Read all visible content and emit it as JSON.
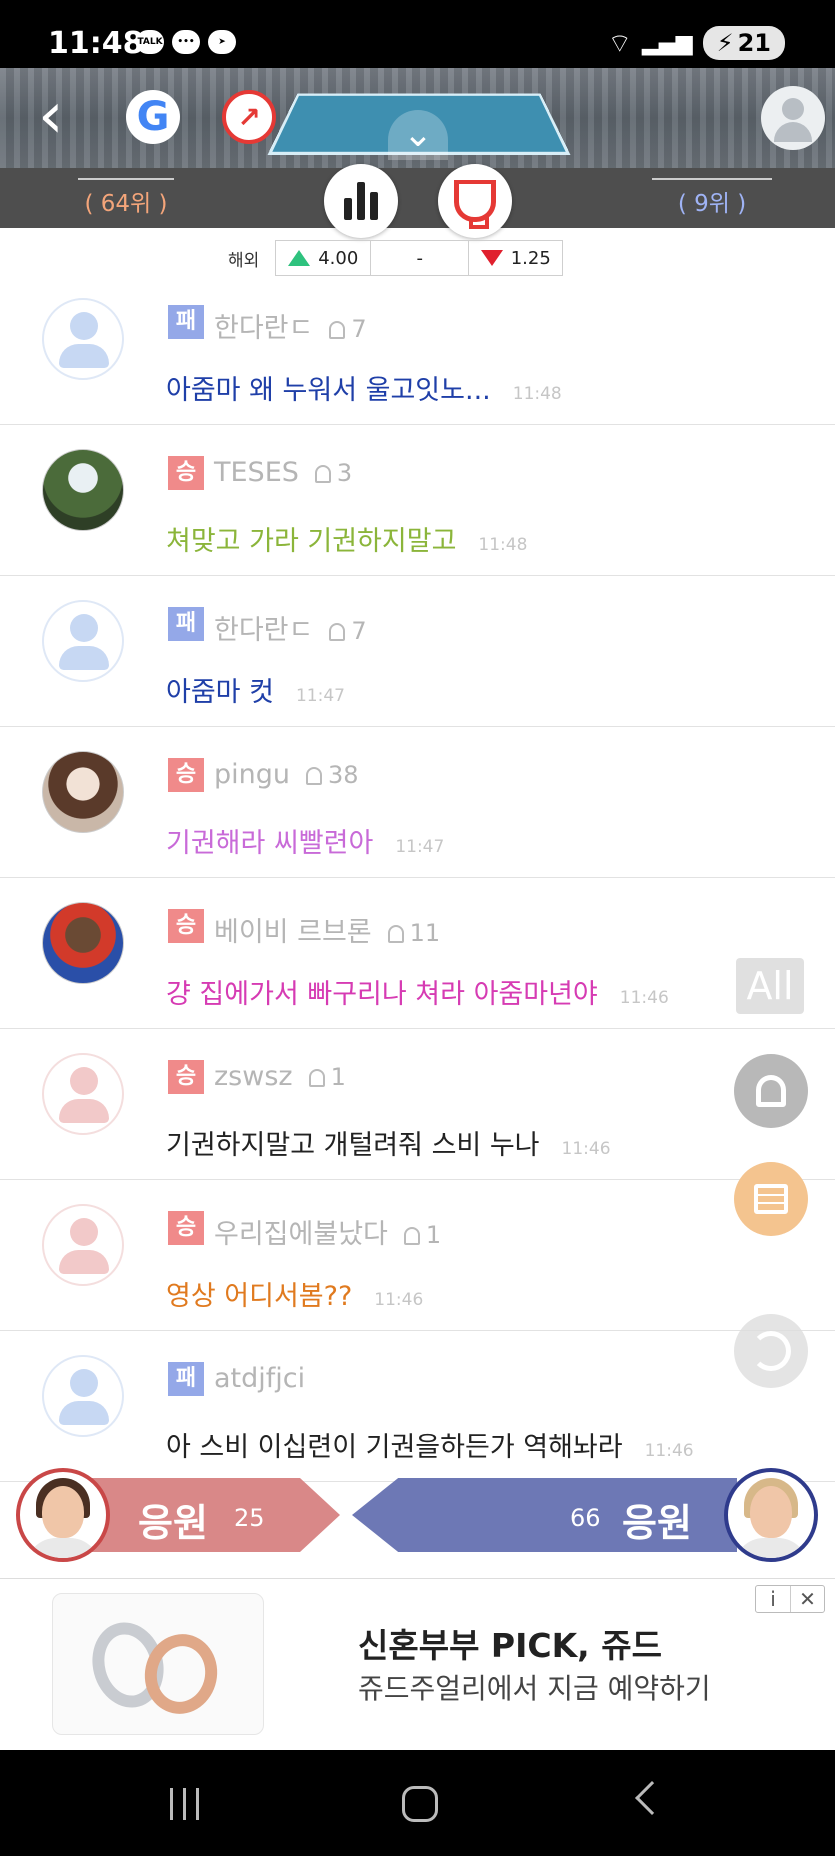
{
  "status_bar": {
    "time": "11:48",
    "battery": "21"
  },
  "header": {
    "google_label": "G"
  },
  "score_bar": {
    "left_rank": "( 64위 )",
    "right_rank": "( 9위 )"
  },
  "odds": {
    "label": "해외",
    "home": "4.00",
    "draw": "-",
    "away": "1.25"
  },
  "comments": [
    {
      "result": "패",
      "user": "한다란ㄷ",
      "count": "7",
      "message": "아줌마 왜 누워서 울고잇노...",
      "time": "11:48",
      "color": "#1f3fa8",
      "avatar": "blue"
    },
    {
      "result": "승",
      "user": "TESES",
      "count": "3",
      "message": "쳐맞고 가라 기권하지말고",
      "time": "11:48",
      "color": "#8bb53a",
      "avatar": "photo1"
    },
    {
      "result": "패",
      "user": "한다란ㄷ",
      "count": "7",
      "message": "아줌마 컷",
      "time": "11:47",
      "color": "#1f3fa8",
      "avatar": "blue"
    },
    {
      "result": "승",
      "user": "pingu",
      "count": "38",
      "message": "기권해라 씨빨련아",
      "time": "11:47",
      "color": "#c86ad8",
      "avatar": "photo2"
    },
    {
      "result": "승",
      "user": "베이비 르브론",
      "count": "11",
      "message": "걍 집에가서 빠구리나 쳐라 아줌마년야",
      "time": "11:46",
      "color": "#d63bb3",
      "avatar": "photo3"
    },
    {
      "result": "승",
      "user": "zswsz",
      "count": "1",
      "message": "기권하지말고 개털려줘 스비 누나",
      "time": "11:46",
      "color": "#222222",
      "avatar": "pink"
    },
    {
      "result": "승",
      "user": "우리집에불났다",
      "count": "1",
      "message": "영상 어디서봄??",
      "time": "11:46",
      "color": "#e07a1f",
      "avatar": "pink"
    },
    {
      "result": "패",
      "user": "atdjfjci",
      "count": "",
      "message": "아 스비 이십련이 기권을하든가 역해놔라",
      "time": "11:46",
      "color": "#222222",
      "avatar": "blue"
    }
  ],
  "fabs": {
    "all_label": "All"
  },
  "support": {
    "left_label": "응원",
    "left_count": "25",
    "right_label": "응원",
    "right_count": "66"
  },
  "ad": {
    "title": "신혼부부 PICK, 쥬드",
    "subtitle": "쥬드주얼리에서 지금 예약하기",
    "info_label": "i",
    "close_label": "✕"
  },
  "colors": {
    "lose_badge": "#94a8e8",
    "win_badge": "#f08a8a",
    "support_left": "#d98888",
    "support_right": "#6d78b5"
  }
}
